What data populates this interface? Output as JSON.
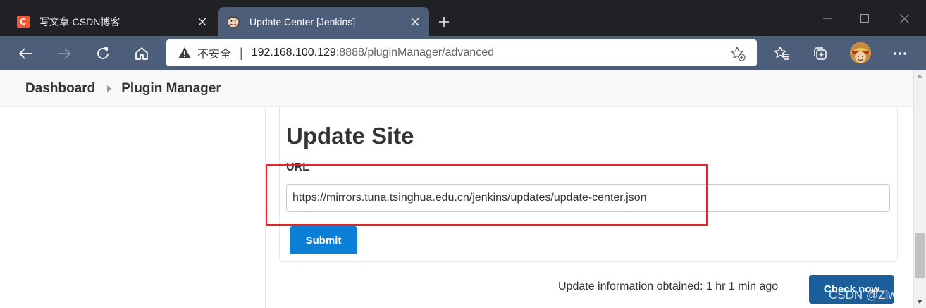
{
  "browser": {
    "tabs": [
      {
        "title": "写文章-CSDN博客",
        "favicon": "C",
        "active": false
      },
      {
        "title": "Update Center [Jenkins]",
        "active": true
      }
    ],
    "address": {
      "security_label": "不安全",
      "separator": "|",
      "url_host": "192.168.100.129",
      "url_rest": ":8888/pluginManager/advanced"
    }
  },
  "breadcrumbs": [
    "Dashboard",
    "Plugin Manager"
  ],
  "update_site": {
    "heading": "Update Site",
    "url_label": "URL",
    "url_value": "https://mirrors.tuna.tsinghua.edu.cn/jenkins/updates/update-center.json",
    "submit_label": "Submit"
  },
  "footer": {
    "update_info": "Update information obtained: 1 hr 1 min ago",
    "check_now_label": "Check now"
  },
  "watermark": "CSDN @Zlwriii",
  "colors": {
    "accent": "#0b7fd6",
    "check_button": "#1b5e9c",
    "highlight": "#e0262e",
    "toolbar": "#4c5e7a"
  }
}
